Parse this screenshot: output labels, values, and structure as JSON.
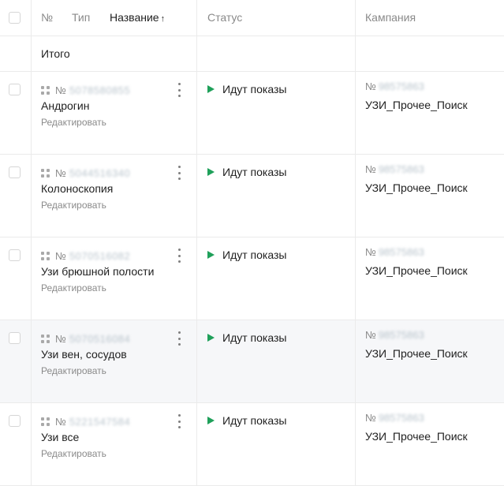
{
  "header": {
    "number_label": "№",
    "type_label": "Тип",
    "name_label": "Название",
    "sort_indicator": "↑",
    "status_label": "Статус",
    "campaign_label": "Кампания"
  },
  "total": {
    "label": "Итого"
  },
  "rows": [
    {
      "id_prefix": "№",
      "id": "5078580855",
      "name": "Андрогин",
      "edit": "Редактировать",
      "status": "Идут показы",
      "campaign_prefix": "№",
      "campaign_id": "98575863",
      "campaign_name": "УЗИ_Прочее_Поиск"
    },
    {
      "id_prefix": "№",
      "id": "5044516340",
      "name": "Колоноскопия",
      "edit": "Редактировать",
      "status": "Идут показы",
      "campaign_prefix": "№",
      "campaign_id": "98575863",
      "campaign_name": "УЗИ_Прочее_Поиск"
    },
    {
      "id_prefix": "№",
      "id": "5070516082",
      "name": "Узи брюшной полости",
      "edit": "Редактировать",
      "status": "Идут показы",
      "campaign_prefix": "№",
      "campaign_id": "98575863",
      "campaign_name": "УЗИ_Прочее_Поиск"
    },
    {
      "id_prefix": "№",
      "id": "5070516084",
      "name": "Узи вен, сосудов",
      "edit": "Редактировать",
      "status": "Идут показы",
      "campaign_prefix": "№",
      "campaign_id": "98575863",
      "campaign_name": "УЗИ_Прочее_Поиск"
    },
    {
      "id_prefix": "№",
      "id": "5221547584",
      "name": "Узи все",
      "edit": "Редактировать",
      "status": "Идут показы",
      "campaign_prefix": "№",
      "campaign_id": "98575863",
      "campaign_name": "УЗИ_Прочее_Поиск"
    }
  ],
  "colors": {
    "status_active": "#1fa05a",
    "hover_row": "#f6f7f9",
    "grid_line": "#ebebeb"
  },
  "icons": {
    "status": "play-icon",
    "ad_type": "grid-icon",
    "row_menu": "kebab-menu-icon"
  }
}
